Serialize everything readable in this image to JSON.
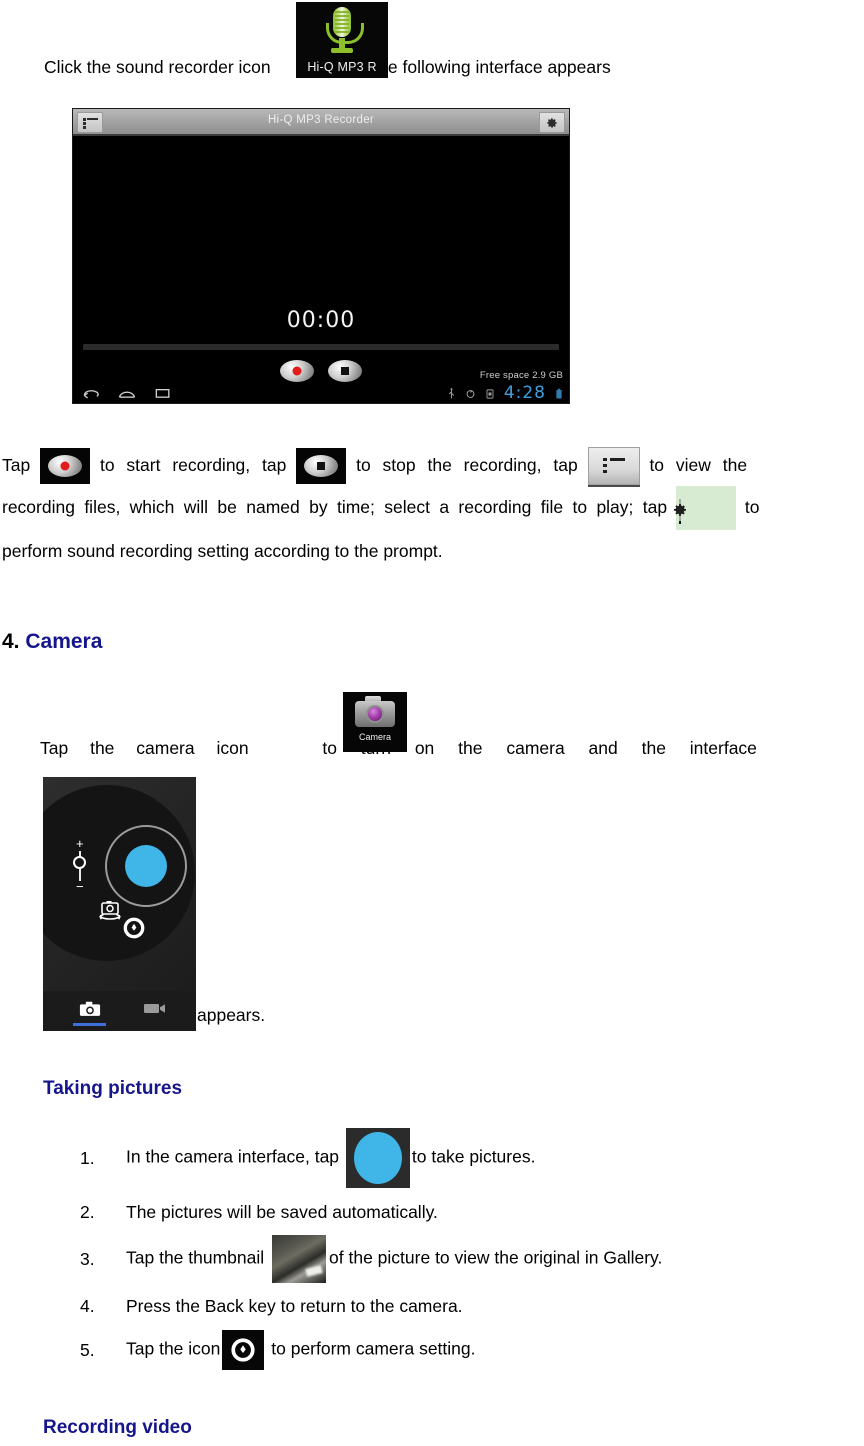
{
  "intro": {
    "before_icon": "Click the sound recorder icon",
    "after_icon": ".The following interface appears"
  },
  "app_icons": {
    "hiq_recorder": {
      "label": "Hi-Q MP3 R",
      "icon_name": "microphone-icon"
    },
    "camera": {
      "label": "Camera",
      "icon_name": "camera-app-icon"
    }
  },
  "recorder_screenshot": {
    "title": "Hi-Q MP3 Recorder",
    "menu_icon": "list-icon",
    "settings_icon": "gear-icon",
    "timer": "00:00",
    "record_button_icon": "record-dot-icon",
    "stop_button_icon": "stop-square-icon",
    "free_space": "Free space 2.9 GB",
    "clock": "4:28",
    "nav": {
      "back_icon": "back-arrow-icon",
      "home_icon": "home-icon",
      "recents_icon": "recents-icon"
    },
    "status_icons": [
      "usb-icon",
      "sync-icon",
      "sd-card-icon",
      "battery-icon"
    ]
  },
  "recorder_paragraph": {
    "s1": "Tap",
    "s2": "to start recording, tap",
    "s3": "to stop the recording, tap",
    "s4": "to view the",
    "s5": "recording files, which will be named by time; select a recording file to play; tap",
    "s6": "to",
    "s7": "perform sound recording setting according to the prompt."
  },
  "camera_section": {
    "number": "4.",
    "title": "Camera",
    "intro_before": "Tap the camera icon",
    "intro_after": "to turn on the camera and the interface",
    "appears": "appears."
  },
  "camera_screenshot": {
    "shutter_icon": "shutter-button",
    "zoom_plus": "+",
    "zoom_minus": "−",
    "switch_camera_icon": "switch-camera-icon",
    "settings_icon": "camera-settings-icon",
    "photo_mode_icon": "photo-mode-icon",
    "video_mode_icon": "video-mode-icon"
  },
  "taking_pictures": {
    "heading": "Taking pictures",
    "items": [
      {
        "num": "1.",
        "before": "In the camera interface, tap",
        "after": "to take pictures.",
        "icon": "shutter-button"
      },
      {
        "num": "2.",
        "before": "The pictures will be saved automatically.",
        "after": "",
        "icon": ""
      },
      {
        "num": "3.",
        "before": "Tap the thumbnail",
        "after": "of the picture to view the original in Gallery.",
        "icon": "photo-thumbnail"
      },
      {
        "num": "4.",
        "before": "Press the Back key to return to the camera.",
        "after": "",
        "icon": ""
      },
      {
        "num": "5.",
        "before": "Tap the icon",
        "after": "to perform camera setting.",
        "icon": "camera-settings-icon"
      }
    ]
  },
  "recording_video": {
    "heading": "Recording video"
  },
  "colors": {
    "heading_blue": "#16168c",
    "shutter_blue": "#3fb5e8",
    "clock_blue": "#3f9fe0",
    "mode_underline": "#3f6fd8",
    "record_red": "#e21b1b",
    "mic_green": "#8dbf2a"
  }
}
